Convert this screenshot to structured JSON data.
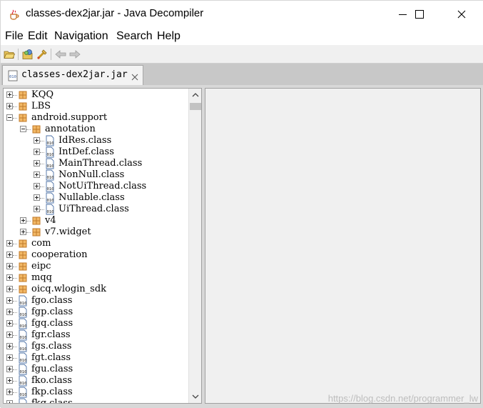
{
  "window": {
    "title": "classes-dex2jar.jar - Java Decompiler",
    "minimize_glyph": "—",
    "close_glyph": "✕"
  },
  "menubar": {
    "items": [
      "File",
      "Edit",
      "Navigation",
      "Search",
      "Help"
    ]
  },
  "toolbar": {
    "buttons": [
      "open-file-icon",
      "open-type-icon",
      "open-type-hierarchy-icon",
      "back-icon",
      "forward-icon"
    ]
  },
  "tab": {
    "label": "classes-dex2jar.jar",
    "close_glyph": "✕"
  },
  "tree": {
    "nodes": [
      {
        "label": "KQQ",
        "kind": "package",
        "level": 0,
        "expanded": false
      },
      {
        "label": "LBS",
        "kind": "package",
        "level": 0,
        "expanded": false
      },
      {
        "label": "android.support",
        "kind": "package",
        "level": 0,
        "expanded": true
      },
      {
        "label": "annotation",
        "kind": "package",
        "level": 1,
        "expanded": true
      },
      {
        "label": "IdRes.class",
        "kind": "class",
        "level": 2,
        "expanded": false
      },
      {
        "label": "IntDef.class",
        "kind": "class",
        "level": 2,
        "expanded": false
      },
      {
        "label": "MainThread.class",
        "kind": "class",
        "level": 2,
        "expanded": false
      },
      {
        "label": "NonNull.class",
        "kind": "class",
        "level": 2,
        "expanded": false
      },
      {
        "label": "NotUiThread.class",
        "kind": "class",
        "level": 2,
        "expanded": false
      },
      {
        "label": "Nullable.class",
        "kind": "class",
        "level": 2,
        "expanded": false
      },
      {
        "label": "UiThread.class",
        "kind": "class",
        "level": 2,
        "expanded": false
      },
      {
        "label": "v4",
        "kind": "package",
        "level": 1,
        "expanded": false
      },
      {
        "label": "v7.widget",
        "kind": "package",
        "level": 1,
        "expanded": false
      },
      {
        "label": "com",
        "kind": "package",
        "level": 0,
        "expanded": false
      },
      {
        "label": "cooperation",
        "kind": "package",
        "level": 0,
        "expanded": false
      },
      {
        "label": "eipc",
        "kind": "package",
        "level": 0,
        "expanded": false
      },
      {
        "label": "mqq",
        "kind": "package",
        "level": 0,
        "expanded": false
      },
      {
        "label": "oicq.wlogin_sdk",
        "kind": "package",
        "level": 0,
        "expanded": false
      },
      {
        "label": "fgo.class",
        "kind": "class",
        "level": 0,
        "expanded": false
      },
      {
        "label": "fgp.class",
        "kind": "class",
        "level": 0,
        "expanded": false
      },
      {
        "label": "fgq.class",
        "kind": "class",
        "level": 0,
        "expanded": false
      },
      {
        "label": "fgr.class",
        "kind": "class",
        "level": 0,
        "expanded": false
      },
      {
        "label": "fgs.class",
        "kind": "class",
        "level": 0,
        "expanded": false
      },
      {
        "label": "fgt.class",
        "kind": "class",
        "level": 0,
        "expanded": false
      },
      {
        "label": "fgu.class",
        "kind": "class",
        "level": 0,
        "expanded": false
      },
      {
        "label": "fko.class",
        "kind": "class",
        "level": 0,
        "expanded": false
      },
      {
        "label": "fkp.class",
        "kind": "class",
        "level": 0,
        "expanded": false
      },
      {
        "label": "fkq.class",
        "kind": "class",
        "level": 0,
        "expanded": false
      }
    ]
  },
  "watermark": "https://blog.csdn.net/programmer_lw",
  "colors": {
    "package_icon": "#c07a2a",
    "class_icon_border": "#4a6fa5",
    "tab_area": "#c8c8c8",
    "editor_bg": "#f0f0f0"
  }
}
